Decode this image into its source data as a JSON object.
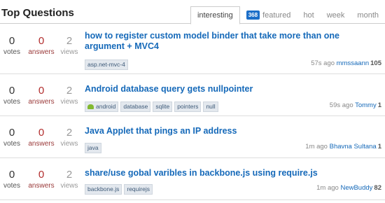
{
  "header": {
    "title": "Top Questions",
    "tabs": [
      {
        "label": "interesting"
      },
      {
        "badge": "368",
        "label": "featured"
      },
      {
        "label": "hot"
      },
      {
        "label": "week"
      },
      {
        "label": "month"
      }
    ]
  },
  "stat_labels": {
    "votes": "votes",
    "answers": "answers",
    "views": "views"
  },
  "questions": [
    {
      "votes": "0",
      "answers": "0",
      "views": "2",
      "title": "how to register custom model binder that take more than one argument + MVC4",
      "tags": [
        "asp.net-mvc-4"
      ],
      "time": "57s ago",
      "user": "mmssaann",
      "rep": "105"
    },
    {
      "votes": "0",
      "answers": "0",
      "views": "2",
      "title": "Android database query gets nullpointer",
      "tags": [
        "android",
        "database",
        "sqlite",
        "pointers",
        "null"
      ],
      "time": "59s ago",
      "user": "Tommy",
      "rep": "1"
    },
    {
      "votes": "0",
      "answers": "0",
      "views": "2",
      "title": "Java Applet that pings an IP address",
      "tags": [
        "java"
      ],
      "time": "1m ago",
      "user": "Bhavna Sultana",
      "rep": "1"
    },
    {
      "votes": "0",
      "answers": "0",
      "views": "2",
      "title": "share/use gobal varibles in backbone.js using require.js",
      "tags": [
        "backbone.js",
        "requirejs"
      ],
      "time": "1m ago",
      "user": "NewBuddy",
      "rep": "82"
    }
  ]
}
